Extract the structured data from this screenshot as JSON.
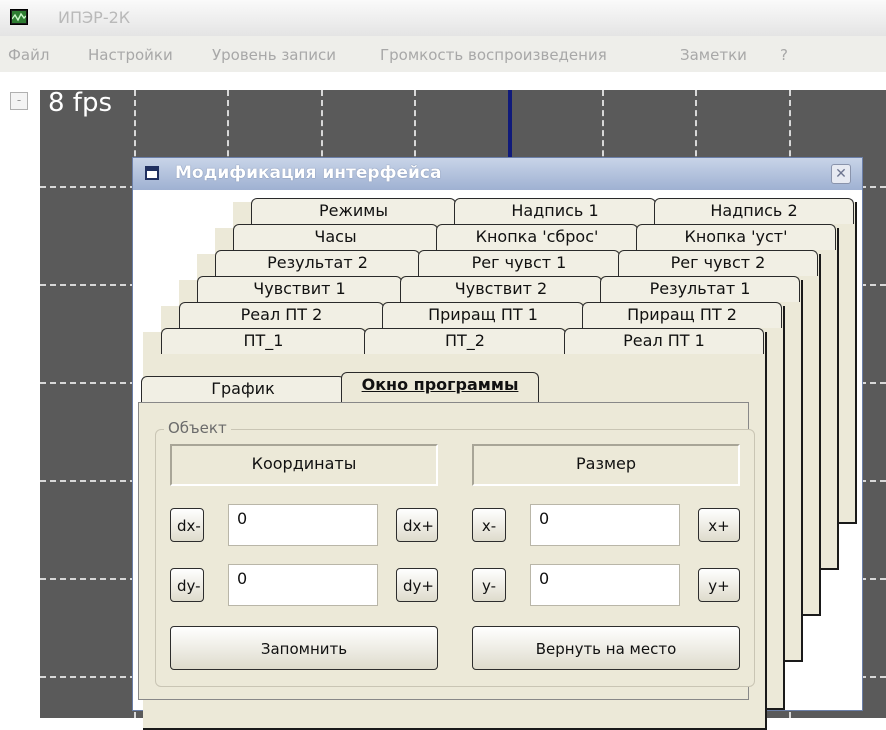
{
  "app": {
    "title": "ИПЭР-2К"
  },
  "menu": [
    "Файл",
    "Настройки",
    "Уровень записи",
    "Громкость воспроизведения",
    "Заметки",
    "?"
  ],
  "scope": {
    "fps_label": "8 fps",
    "collapse_symbol": "-"
  },
  "dialog": {
    "title": "Модификация интерфейса",
    "close_symbol": "✕",
    "tab_rows": [
      [
        "Режимы",
        "Надпись 1",
        "Надпись 2"
      ],
      [
        "Часы",
        "Кнопка 'сброс'",
        "Кнопка 'уст'"
      ],
      [
        "Результат 2",
        "Рег чувст 1",
        "Рег чувст 2"
      ],
      [
        "Чувствит 1",
        "Чувствит 2",
        "Результат 1"
      ],
      [
        "Реал ПТ 2",
        "Приращ ПТ 1",
        "Приращ ПТ 2"
      ],
      [
        "ПТ_1",
        "ПТ_2",
        "Реал ПТ 1"
      ],
      [
        "График",
        "Окно программы"
      ]
    ],
    "active_tab": "Окно программы",
    "group": {
      "label": "Объект",
      "coords_label": "Координаты",
      "size_label": "Размер",
      "dx_minus": "dx-",
      "dx_plus": "dx+",
      "dx_value": "0",
      "dy_minus": "dy-",
      "dy_plus": "dy+",
      "dy_value": "0",
      "x_minus": "x-",
      "x_plus": "x+",
      "x_value": "0",
      "y_minus": "y-",
      "y_plus": "y+",
      "y_value": "0",
      "save_label": "Запомнить",
      "restore_label": "Вернуть на место"
    }
  },
  "colors": {
    "scope_bg": "#5a5a5a",
    "center_line": "#101a7a",
    "dialog_face": "#ece9d8"
  }
}
